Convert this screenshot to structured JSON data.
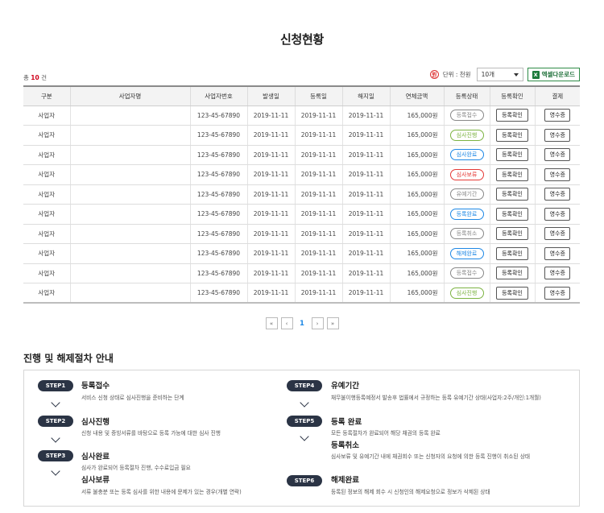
{
  "title": "신청현황",
  "summary": {
    "prefix": "총",
    "count": "10",
    "suffix": "건"
  },
  "toolbar": {
    "unit_icon": "원",
    "unit_text": "단위 : 천원",
    "page_size": "10개",
    "excel_icon": "X",
    "excel_label": "엑셀다운로드"
  },
  "table": {
    "headers": [
      "구분",
      "사업자명",
      "사업자번호",
      "발생일",
      "등록일",
      "해지일",
      "연체금액",
      "등록상태",
      "등록확인",
      "결제"
    ],
    "rows": [
      {
        "type": "사업자",
        "name": "",
        "biz_no": "123-45-67890",
        "occurred": "2019-11-11",
        "registered": "2019-11-11",
        "cancelled": "2019-11-11",
        "amount": "165,000원",
        "status": "등록접수",
        "confirm": "등록확인",
        "pay": "영수증"
      },
      {
        "type": "사업자",
        "name": "",
        "biz_no": "123-45-67890",
        "occurred": "2019-11-11",
        "registered": "2019-11-11",
        "cancelled": "2019-11-11",
        "amount": "165,000원",
        "status": "심사진행",
        "confirm": "등록확인",
        "pay": "영수증"
      },
      {
        "type": "사업자",
        "name": "",
        "biz_no": "123-45-67890",
        "occurred": "2019-11-11",
        "registered": "2019-11-11",
        "cancelled": "2019-11-11",
        "amount": "165,000원",
        "status": "심사완료",
        "confirm": "등록확인",
        "pay": "영수증"
      },
      {
        "type": "사업자",
        "name": "",
        "biz_no": "123-45-67890",
        "occurred": "2019-11-11",
        "registered": "2019-11-11",
        "cancelled": "2019-11-11",
        "amount": "165,000원",
        "status": "심사보류",
        "confirm": "등록확인",
        "pay": "영수증"
      },
      {
        "type": "사업자",
        "name": "",
        "biz_no": "123-45-67890",
        "occurred": "2019-11-11",
        "registered": "2019-11-11",
        "cancelled": "2019-11-11",
        "amount": "165,000원",
        "status": "유예기간",
        "confirm": "등록확인",
        "pay": "영수증"
      },
      {
        "type": "사업자",
        "name": "",
        "biz_no": "123-45-67890",
        "occurred": "2019-11-11",
        "registered": "2019-11-11",
        "cancelled": "2019-11-11",
        "amount": "165,000원",
        "status": "등록완료",
        "confirm": "등록확인",
        "pay": "영수증"
      },
      {
        "type": "사업자",
        "name": "",
        "biz_no": "123-45-67890",
        "occurred": "2019-11-11",
        "registered": "2019-11-11",
        "cancelled": "2019-11-11",
        "amount": "165,000원",
        "status": "등록취소",
        "confirm": "등록확인",
        "pay": "영수증"
      },
      {
        "type": "사업자",
        "name": "",
        "biz_no": "123-45-67890",
        "occurred": "2019-11-11",
        "registered": "2019-11-11",
        "cancelled": "2019-11-11",
        "amount": "165,000원",
        "status": "해제완료",
        "confirm": "등록확인",
        "pay": "영수증"
      },
      {
        "type": "사업자",
        "name": "",
        "biz_no": "123-45-67890",
        "occurred": "2019-11-11",
        "registered": "2019-11-11",
        "cancelled": "2019-11-11",
        "amount": "165,000원",
        "status": "등록접수",
        "confirm": "등록확인",
        "pay": "영수증"
      },
      {
        "type": "사업자",
        "name": "",
        "biz_no": "123-45-67890",
        "occurred": "2019-11-11",
        "registered": "2019-11-11",
        "cancelled": "2019-11-11",
        "amount": "165,000원",
        "status": "심사진행",
        "confirm": "등록확인",
        "pay": "영수증"
      }
    ]
  },
  "status_colors": {
    "등록접수": "#888888",
    "심사진행": "#7cb342",
    "심사완료": "#1e88e5",
    "심사보류": "#e53935",
    "유예기간": "#888888",
    "등록완료": "#1e88e5",
    "등록취소": "#888888",
    "해제완료": "#1e88e5"
  },
  "pagination": {
    "first": "«",
    "prev": "‹",
    "current": "1",
    "next": "›",
    "last": "»"
  },
  "guide": {
    "title": "진행 및 해제절차 안내",
    "steps": [
      {
        "badge": "STEP1",
        "name": "등록접수",
        "desc": "서비스 신청 상태로 심사진행을 준비하는 단계"
      },
      {
        "badge": "STEP2",
        "name": "심사진행",
        "desc": "신청 내용 및 증빙서류를 바탕으로 등록 가능에 대한 심사 진행"
      },
      {
        "badge": "STEP3",
        "name": "심사완료",
        "desc": "심사가 완료되어 등록절차 진행, 수수료입금 필요"
      },
      {
        "badge": "",
        "name": "심사보류",
        "desc": "서류 불충분 또는 등록 심사를 위한 내용에 문제가 있는 경우(개별 연락)"
      },
      {
        "badge": "STEP4",
        "name": "유예기간",
        "desc": "채무불이행등록예정서 발송후 법률에서 규정하는 등록 유예기간 상태(사업자:2주/개인:1개월)"
      },
      {
        "badge": "STEP5",
        "name": "등록 완료",
        "desc": "모든 등록절차가 완료되어 해당 채권의 등록 완료"
      },
      {
        "badge": "",
        "name": "등록취소",
        "desc": "심사보류 및 유예기간 내에 채권회수 또는 신청자의 요청에 의한 등록 진행이 취소된 상태"
      },
      {
        "badge": "STEP6",
        "name": "해제완료",
        "desc": "등록된 정보의 해제 회수 시 신청인의 해제요청으로 정보가 삭제된 상태"
      }
    ]
  }
}
